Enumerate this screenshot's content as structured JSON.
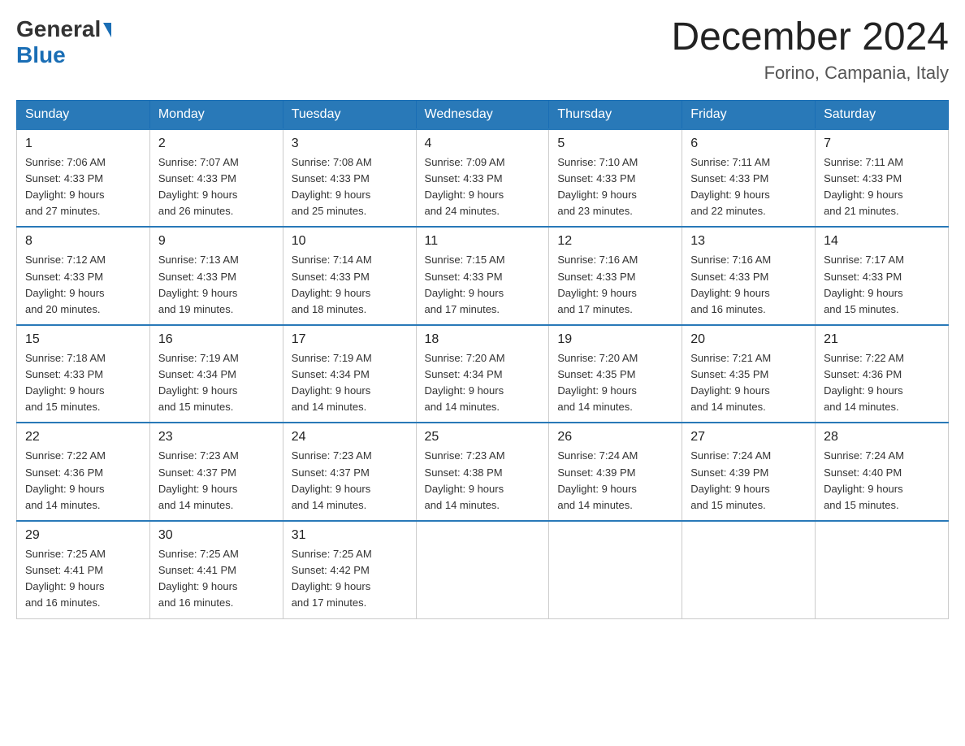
{
  "header": {
    "logo_general": "General",
    "logo_blue": "Blue",
    "month_title": "December 2024",
    "location": "Forino, Campania, Italy"
  },
  "calendar": {
    "days_of_week": [
      "Sunday",
      "Monday",
      "Tuesday",
      "Wednesday",
      "Thursday",
      "Friday",
      "Saturday"
    ],
    "weeks": [
      [
        {
          "day": "1",
          "sunrise": "7:06 AM",
          "sunset": "4:33 PM",
          "daylight": "9 hours and 27 minutes."
        },
        {
          "day": "2",
          "sunrise": "7:07 AM",
          "sunset": "4:33 PM",
          "daylight": "9 hours and 26 minutes."
        },
        {
          "day": "3",
          "sunrise": "7:08 AM",
          "sunset": "4:33 PM",
          "daylight": "9 hours and 25 minutes."
        },
        {
          "day": "4",
          "sunrise": "7:09 AM",
          "sunset": "4:33 PM",
          "daylight": "9 hours and 24 minutes."
        },
        {
          "day": "5",
          "sunrise": "7:10 AM",
          "sunset": "4:33 PM",
          "daylight": "9 hours and 23 minutes."
        },
        {
          "day": "6",
          "sunrise": "7:11 AM",
          "sunset": "4:33 PM",
          "daylight": "9 hours and 22 minutes."
        },
        {
          "day": "7",
          "sunrise": "7:11 AM",
          "sunset": "4:33 PM",
          "daylight": "9 hours and 21 minutes."
        }
      ],
      [
        {
          "day": "8",
          "sunrise": "7:12 AM",
          "sunset": "4:33 PM",
          "daylight": "9 hours and 20 minutes."
        },
        {
          "day": "9",
          "sunrise": "7:13 AM",
          "sunset": "4:33 PM",
          "daylight": "9 hours and 19 minutes."
        },
        {
          "day": "10",
          "sunrise": "7:14 AM",
          "sunset": "4:33 PM",
          "daylight": "9 hours and 18 minutes."
        },
        {
          "day": "11",
          "sunrise": "7:15 AM",
          "sunset": "4:33 PM",
          "daylight": "9 hours and 17 minutes."
        },
        {
          "day": "12",
          "sunrise": "7:16 AM",
          "sunset": "4:33 PM",
          "daylight": "9 hours and 17 minutes."
        },
        {
          "day": "13",
          "sunrise": "7:16 AM",
          "sunset": "4:33 PM",
          "daylight": "9 hours and 16 minutes."
        },
        {
          "day": "14",
          "sunrise": "7:17 AM",
          "sunset": "4:33 PM",
          "daylight": "9 hours and 15 minutes."
        }
      ],
      [
        {
          "day": "15",
          "sunrise": "7:18 AM",
          "sunset": "4:33 PM",
          "daylight": "9 hours and 15 minutes."
        },
        {
          "day": "16",
          "sunrise": "7:19 AM",
          "sunset": "4:34 PM",
          "daylight": "9 hours and 15 minutes."
        },
        {
          "day": "17",
          "sunrise": "7:19 AM",
          "sunset": "4:34 PM",
          "daylight": "9 hours and 14 minutes."
        },
        {
          "day": "18",
          "sunrise": "7:20 AM",
          "sunset": "4:34 PM",
          "daylight": "9 hours and 14 minutes."
        },
        {
          "day": "19",
          "sunrise": "7:20 AM",
          "sunset": "4:35 PM",
          "daylight": "9 hours and 14 minutes."
        },
        {
          "day": "20",
          "sunrise": "7:21 AM",
          "sunset": "4:35 PM",
          "daylight": "9 hours and 14 minutes."
        },
        {
          "day": "21",
          "sunrise": "7:22 AM",
          "sunset": "4:36 PM",
          "daylight": "9 hours and 14 minutes."
        }
      ],
      [
        {
          "day": "22",
          "sunrise": "7:22 AM",
          "sunset": "4:36 PM",
          "daylight": "9 hours and 14 minutes."
        },
        {
          "day": "23",
          "sunrise": "7:23 AM",
          "sunset": "4:37 PM",
          "daylight": "9 hours and 14 minutes."
        },
        {
          "day": "24",
          "sunrise": "7:23 AM",
          "sunset": "4:37 PM",
          "daylight": "9 hours and 14 minutes."
        },
        {
          "day": "25",
          "sunrise": "7:23 AM",
          "sunset": "4:38 PM",
          "daylight": "9 hours and 14 minutes."
        },
        {
          "day": "26",
          "sunrise": "7:24 AM",
          "sunset": "4:39 PM",
          "daylight": "9 hours and 14 minutes."
        },
        {
          "day": "27",
          "sunrise": "7:24 AM",
          "sunset": "4:39 PM",
          "daylight": "9 hours and 15 minutes."
        },
        {
          "day": "28",
          "sunrise": "7:24 AM",
          "sunset": "4:40 PM",
          "daylight": "9 hours and 15 minutes."
        }
      ],
      [
        {
          "day": "29",
          "sunrise": "7:25 AM",
          "sunset": "4:41 PM",
          "daylight": "9 hours and 16 minutes."
        },
        {
          "day": "30",
          "sunrise": "7:25 AM",
          "sunset": "4:41 PM",
          "daylight": "9 hours and 16 minutes."
        },
        {
          "day": "31",
          "sunrise": "7:25 AM",
          "sunset": "4:42 PM",
          "daylight": "9 hours and 17 minutes."
        },
        null,
        null,
        null,
        null
      ]
    ],
    "sunrise_label": "Sunrise:",
    "sunset_label": "Sunset:",
    "daylight_label": "Daylight:"
  }
}
